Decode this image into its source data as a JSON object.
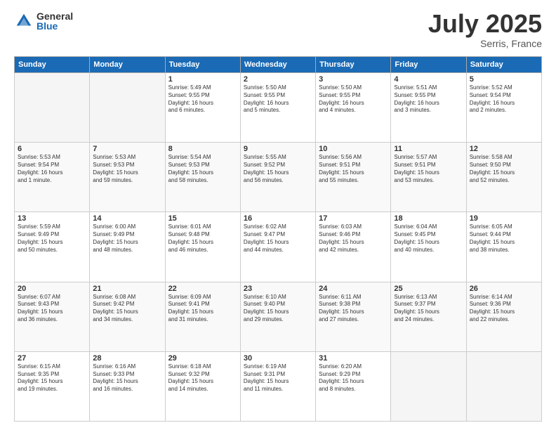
{
  "header": {
    "logo_general": "General",
    "logo_blue": "Blue",
    "month_title": "July 2025",
    "location": "Serris, France"
  },
  "days_of_week": [
    "Sunday",
    "Monday",
    "Tuesday",
    "Wednesday",
    "Thursday",
    "Friday",
    "Saturday"
  ],
  "weeks": [
    [
      {
        "day": "",
        "info": ""
      },
      {
        "day": "",
        "info": ""
      },
      {
        "day": "1",
        "info": "Sunrise: 5:49 AM\nSunset: 9:55 PM\nDaylight: 16 hours\nand 6 minutes."
      },
      {
        "day": "2",
        "info": "Sunrise: 5:50 AM\nSunset: 9:55 PM\nDaylight: 16 hours\nand 5 minutes."
      },
      {
        "day": "3",
        "info": "Sunrise: 5:50 AM\nSunset: 9:55 PM\nDaylight: 16 hours\nand 4 minutes."
      },
      {
        "day": "4",
        "info": "Sunrise: 5:51 AM\nSunset: 9:55 PM\nDaylight: 16 hours\nand 3 minutes."
      },
      {
        "day": "5",
        "info": "Sunrise: 5:52 AM\nSunset: 9:54 PM\nDaylight: 16 hours\nand 2 minutes."
      }
    ],
    [
      {
        "day": "6",
        "info": "Sunrise: 5:53 AM\nSunset: 9:54 PM\nDaylight: 16 hours\nand 1 minute."
      },
      {
        "day": "7",
        "info": "Sunrise: 5:53 AM\nSunset: 9:53 PM\nDaylight: 15 hours\nand 59 minutes."
      },
      {
        "day": "8",
        "info": "Sunrise: 5:54 AM\nSunset: 9:53 PM\nDaylight: 15 hours\nand 58 minutes."
      },
      {
        "day": "9",
        "info": "Sunrise: 5:55 AM\nSunset: 9:52 PM\nDaylight: 15 hours\nand 56 minutes."
      },
      {
        "day": "10",
        "info": "Sunrise: 5:56 AM\nSunset: 9:51 PM\nDaylight: 15 hours\nand 55 minutes."
      },
      {
        "day": "11",
        "info": "Sunrise: 5:57 AM\nSunset: 9:51 PM\nDaylight: 15 hours\nand 53 minutes."
      },
      {
        "day": "12",
        "info": "Sunrise: 5:58 AM\nSunset: 9:50 PM\nDaylight: 15 hours\nand 52 minutes."
      }
    ],
    [
      {
        "day": "13",
        "info": "Sunrise: 5:59 AM\nSunset: 9:49 PM\nDaylight: 15 hours\nand 50 minutes."
      },
      {
        "day": "14",
        "info": "Sunrise: 6:00 AM\nSunset: 9:49 PM\nDaylight: 15 hours\nand 48 minutes."
      },
      {
        "day": "15",
        "info": "Sunrise: 6:01 AM\nSunset: 9:48 PM\nDaylight: 15 hours\nand 46 minutes."
      },
      {
        "day": "16",
        "info": "Sunrise: 6:02 AM\nSunset: 9:47 PM\nDaylight: 15 hours\nand 44 minutes."
      },
      {
        "day": "17",
        "info": "Sunrise: 6:03 AM\nSunset: 9:46 PM\nDaylight: 15 hours\nand 42 minutes."
      },
      {
        "day": "18",
        "info": "Sunrise: 6:04 AM\nSunset: 9:45 PM\nDaylight: 15 hours\nand 40 minutes."
      },
      {
        "day": "19",
        "info": "Sunrise: 6:05 AM\nSunset: 9:44 PM\nDaylight: 15 hours\nand 38 minutes."
      }
    ],
    [
      {
        "day": "20",
        "info": "Sunrise: 6:07 AM\nSunset: 9:43 PM\nDaylight: 15 hours\nand 36 minutes."
      },
      {
        "day": "21",
        "info": "Sunrise: 6:08 AM\nSunset: 9:42 PM\nDaylight: 15 hours\nand 34 minutes."
      },
      {
        "day": "22",
        "info": "Sunrise: 6:09 AM\nSunset: 9:41 PM\nDaylight: 15 hours\nand 31 minutes."
      },
      {
        "day": "23",
        "info": "Sunrise: 6:10 AM\nSunset: 9:40 PM\nDaylight: 15 hours\nand 29 minutes."
      },
      {
        "day": "24",
        "info": "Sunrise: 6:11 AM\nSunset: 9:38 PM\nDaylight: 15 hours\nand 27 minutes."
      },
      {
        "day": "25",
        "info": "Sunrise: 6:13 AM\nSunset: 9:37 PM\nDaylight: 15 hours\nand 24 minutes."
      },
      {
        "day": "26",
        "info": "Sunrise: 6:14 AM\nSunset: 9:36 PM\nDaylight: 15 hours\nand 22 minutes."
      }
    ],
    [
      {
        "day": "27",
        "info": "Sunrise: 6:15 AM\nSunset: 9:35 PM\nDaylight: 15 hours\nand 19 minutes."
      },
      {
        "day": "28",
        "info": "Sunrise: 6:16 AM\nSunset: 9:33 PM\nDaylight: 15 hours\nand 16 minutes."
      },
      {
        "day": "29",
        "info": "Sunrise: 6:18 AM\nSunset: 9:32 PM\nDaylight: 15 hours\nand 14 minutes."
      },
      {
        "day": "30",
        "info": "Sunrise: 6:19 AM\nSunset: 9:31 PM\nDaylight: 15 hours\nand 11 minutes."
      },
      {
        "day": "31",
        "info": "Sunrise: 6:20 AM\nSunset: 9:29 PM\nDaylight: 15 hours\nand 8 minutes."
      },
      {
        "day": "",
        "info": ""
      },
      {
        "day": "",
        "info": ""
      }
    ]
  ]
}
